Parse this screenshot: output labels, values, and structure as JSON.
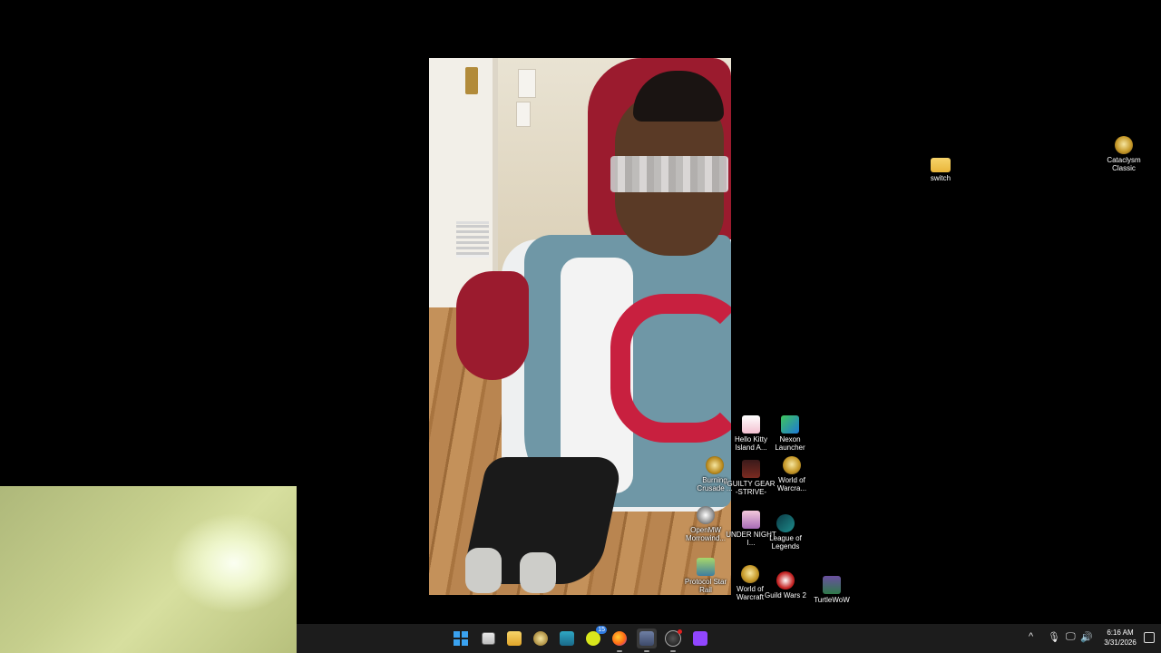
{
  "desktop": {
    "icons": [
      {
        "id": "switch",
        "label": "switch",
        "icon": "folder-icon"
      },
      {
        "id": "cataclysm",
        "label": "Cataclysm Classic",
        "icon": "wow-icon"
      },
      {
        "id": "hellokitty",
        "label": "Hello Kitty Island A...",
        "icon": "hello-kitty-icon"
      },
      {
        "id": "nexon",
        "label": "Nexon Launcher",
        "icon": "nexon-icon"
      },
      {
        "id": "burning",
        "label": "Burning Crusade ...",
        "icon": "wow-icon"
      },
      {
        "id": "guiltygear",
        "label": "GUILTY GEAR -STRIVE-",
        "icon": "guilty-gear-icon"
      },
      {
        "id": "wowretail",
        "label": "World of Warcra...",
        "icon": "wow-icon"
      },
      {
        "id": "morrowind",
        "label": "OpenMW Morrowind...",
        "icon": "morrowind-icon"
      },
      {
        "id": "undernight",
        "label": "UNDER NIGHT I...",
        "icon": "under-night-icon"
      },
      {
        "id": "league",
        "label": "League of Legends",
        "icon": "league-icon"
      },
      {
        "id": "protocol",
        "label": "Protocol Star Rail",
        "icon": "protocol-icon"
      },
      {
        "id": "wow",
        "label": "World of Warcraft",
        "icon": "wow-icon"
      },
      {
        "id": "gw2",
        "label": "Guild Wars 2",
        "icon": "guild-wars-2-icon"
      },
      {
        "id": "turtlewow",
        "label": "TurtleWoW",
        "icon": "turtle-wow-icon"
      }
    ]
  },
  "taskbar": {
    "apps": [
      {
        "name": "start",
        "icon": "windows-start-icon",
        "running": false
      },
      {
        "name": "task-view",
        "icon": "task-view-icon",
        "running": false
      },
      {
        "name": "file-explorer",
        "icon": "folder-icon",
        "running": false
      },
      {
        "name": "world-of-warcraft",
        "icon": "wow-icon",
        "running": false
      },
      {
        "name": "network-tool",
        "icon": "network-icon",
        "running": false
      },
      {
        "name": "chat-app",
        "icon": "chat-icon",
        "running": false,
        "badge": "15"
      },
      {
        "name": "firefox",
        "icon": "firefox-icon",
        "running": true
      },
      {
        "name": "camera-app",
        "icon": "camera-icon",
        "running": true
      },
      {
        "name": "steam",
        "icon": "steam-icon",
        "running": true
      },
      {
        "name": "twitch",
        "icon": "twitch-icon",
        "running": false
      }
    ],
    "tray": {
      "chevron": "^",
      "mic": "🎙",
      "network": "🖵",
      "volume": "🔊",
      "time": "6:16 AM",
      "date": "3/31/2026"
    }
  }
}
